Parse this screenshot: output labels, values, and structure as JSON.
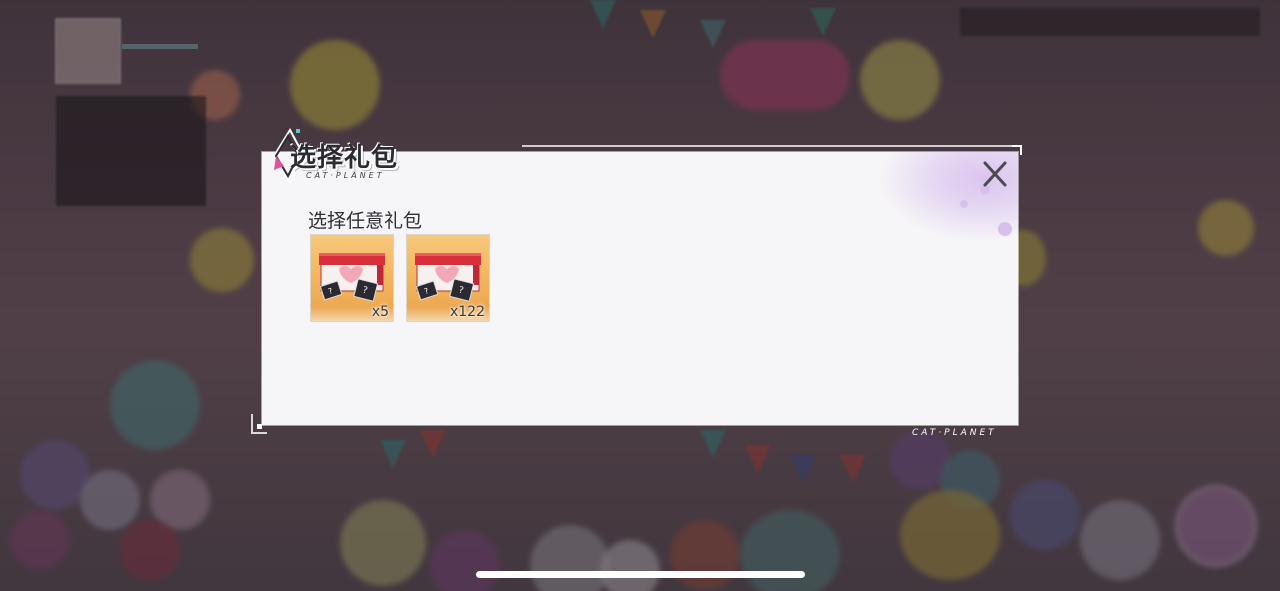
{
  "dialog": {
    "title": "选择礼包",
    "title_subtitle": "CAT·PLANET",
    "section_label": "选择任意礼包",
    "close_icon": "close-icon",
    "items": [
      {
        "icon": "gift-box-icon",
        "quantity": "x5"
      },
      {
        "icon": "gift-box-icon",
        "quantity": "x122"
      }
    ]
  },
  "footer": {
    "brand": "CAT·PLANET"
  },
  "colors": {
    "modal_bg": "#f6f5f7",
    "item_bg": "#f3b25e",
    "title_text": "#2b2b33",
    "accent_splash": "#d7c1ec"
  }
}
